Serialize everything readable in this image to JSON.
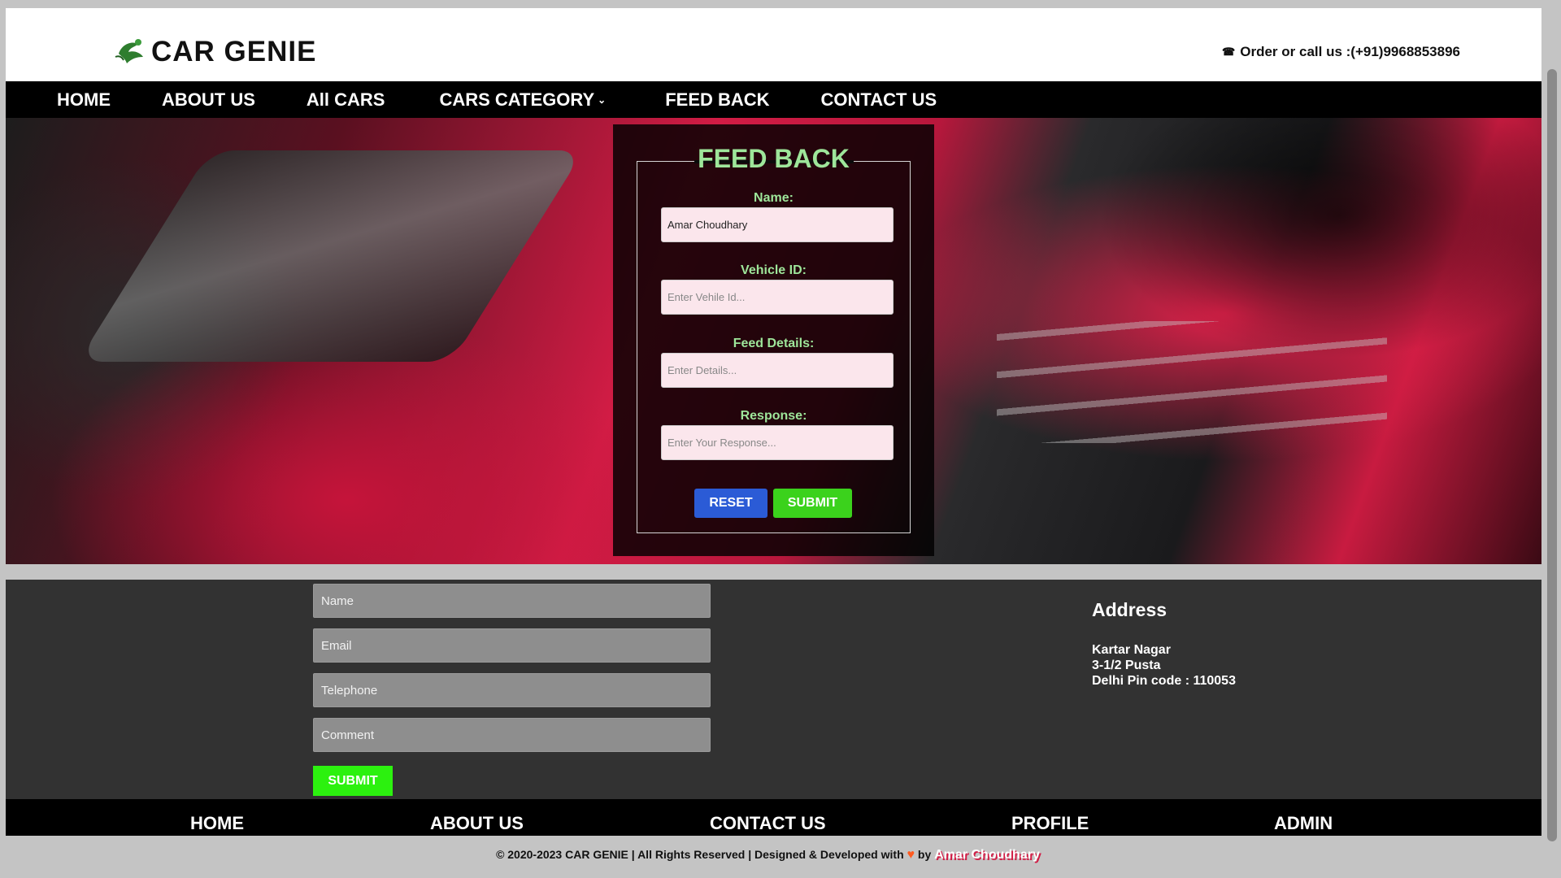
{
  "header": {
    "brand": "CAR GENIE",
    "contact_text": "Order or call us :(+91)9968853896",
    "phone_icon": "telephone-icon"
  },
  "nav": {
    "items": [
      {
        "label": "HOME"
      },
      {
        "label": "ABOUT US"
      },
      {
        "label": "All CARS"
      },
      {
        "label": "CARS CATEGORY"
      },
      {
        "label": "FEED BACK"
      },
      {
        "label": "CONTACT US"
      }
    ]
  },
  "feedback": {
    "title": "FEED BACK",
    "name_label": "Name:",
    "name_value": "Amar Choudhary",
    "vehicle_label": "Vehicle ID:",
    "vehicle_placeholder": "Enter Vehile Id...",
    "details_label": "Feed Details:",
    "details_placeholder": "Enter Details...",
    "response_label": "Response:",
    "response_placeholder": "Enter Your Response...",
    "reset_label": "RESET",
    "submit_label": "SUBMIT"
  },
  "footer_form": {
    "name_placeholder": "Name",
    "email_placeholder": "Email",
    "telephone_placeholder": "Telephone",
    "comment_placeholder": "Comment",
    "submit_label": "SUBMIT"
  },
  "address": {
    "title": "Address",
    "line1": "Kartar Nagar",
    "line2": "3-1/2 Pusta",
    "line3": "Delhi Pin code : 110053"
  },
  "bottom_nav": {
    "items": [
      {
        "label": "HOME"
      },
      {
        "label": "ABOUT US"
      },
      {
        "label": "CONTACT US"
      },
      {
        "label": "PROFILE"
      },
      {
        "label": "ADMIN"
      }
    ]
  },
  "copyright": {
    "text_before": "© 2020-2023 CAR GENIE | All Rights Reserved | Designed & Developed with",
    "text_by": "by",
    "author": "Amar Choudhary"
  },
  "colors": {
    "accent_green": "#9ee69a",
    "reset_blue": "#2b5bd6",
    "submit_green": "#3bd21c",
    "footer_submit": "#2cf10f"
  }
}
